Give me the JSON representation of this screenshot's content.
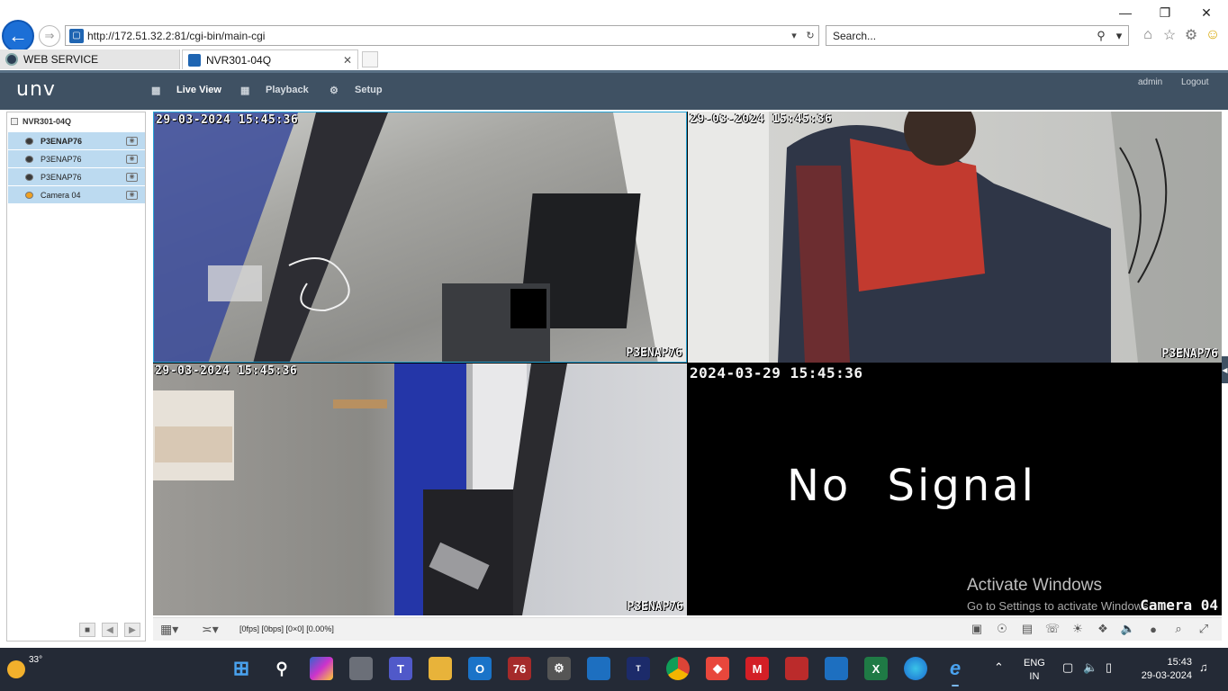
{
  "browser": {
    "url": "http://172.51.32.2:81/cgi-bin/main-cgi",
    "search_placeholder": "Search...",
    "tabs": [
      {
        "label": "WEB SERVICE",
        "active": false
      },
      {
        "label": "NVR301-04Q",
        "active": true
      }
    ]
  },
  "app": {
    "logo": "unv",
    "nav": [
      {
        "label": "Live View",
        "icon": "monitor-icon",
        "active": true
      },
      {
        "label": "Playback",
        "icon": "film-icon",
        "active": false
      },
      {
        "label": "Setup",
        "icon": "gear-icon",
        "active": false
      }
    ],
    "user": "admin",
    "logout": "Logout"
  },
  "device_tree": {
    "device": "NVR301-04Q",
    "cameras": [
      {
        "label": "P3ENAP76",
        "bold": true
      },
      {
        "label": "P3ENAP76",
        "bold": false
      },
      {
        "label": "P3ENAP76",
        "bold": false
      },
      {
        "label": "Camera 04",
        "bold": false
      }
    ]
  },
  "panes": [
    {
      "timestamp": "29-03-2024  15:45:36",
      "name": "P3ENAP76"
    },
    {
      "timestamp": "29-03-2024  15:45:36",
      "name": "P3ENAP76"
    },
    {
      "timestamp": "29-03-2024  15:45:36",
      "name": "P3ENAP76"
    },
    {
      "timestamp": "2024-03-29  15:45:36",
      "name": "Camera  04",
      "no_signal": "No  Signal"
    }
  ],
  "watermark": {
    "line1": "Activate Windows",
    "line2": "Go to Settings to activate Windows."
  },
  "bottom_bar": {
    "status": "[0fps] [0bps] [0×0] [0.00%]"
  },
  "taskbar": {
    "temperature": "33°",
    "language": "ENG",
    "region": "IN",
    "time": "15:43",
    "date": "29-03-2024"
  },
  "colors": {
    "header": "#3f5163",
    "selected_row": "#bcdaf0",
    "selected_pane_border": "#29a6d8",
    "taskbar": "#242a36"
  }
}
